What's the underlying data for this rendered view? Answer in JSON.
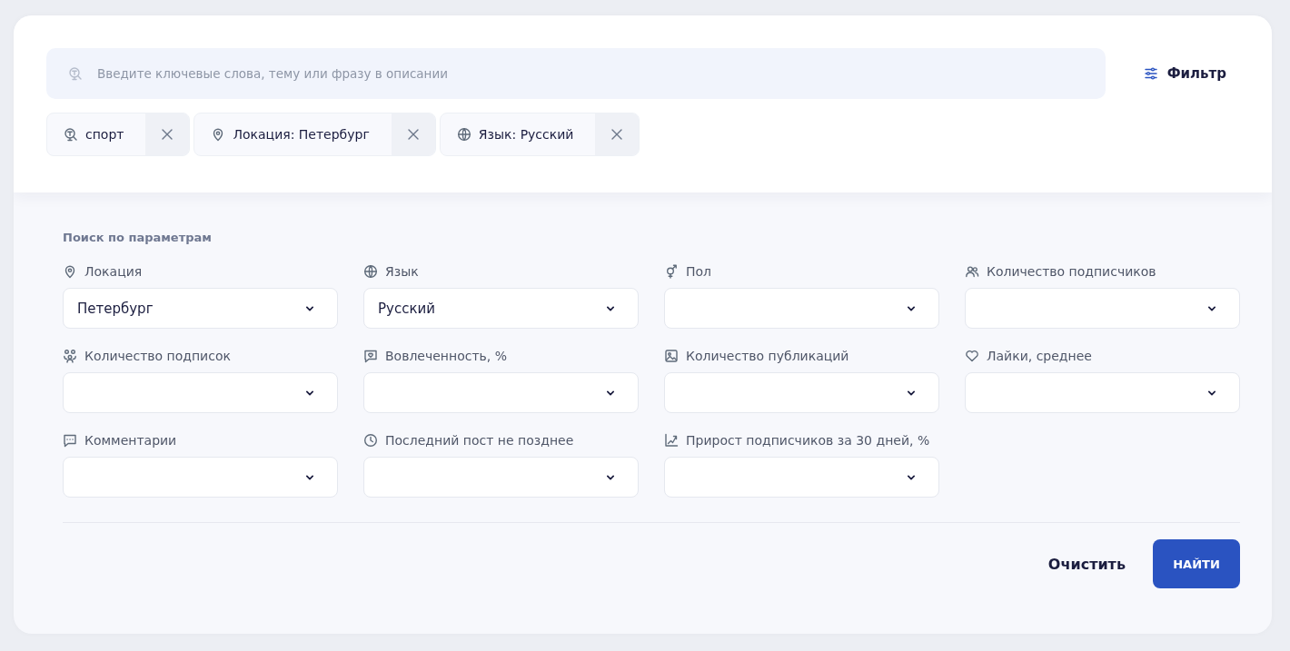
{
  "search": {
    "placeholder": "Введите ключевые слова, тему или фразу в описании"
  },
  "filter_button": {
    "label": "Фильтр"
  },
  "chips": [
    {
      "label": "спорт"
    },
    {
      "label": "Локация: Петербург"
    },
    {
      "label": "Язык: Русский"
    }
  ],
  "params": {
    "title": "Поиск по параметрам",
    "fields": [
      {
        "label": "Локация",
        "value": "Петербург"
      },
      {
        "label": "Язык",
        "value": "Русский"
      },
      {
        "label": "Пол"
      },
      {
        "label": "Количество подписчиков"
      },
      {
        "label": "Количество подписок"
      },
      {
        "label": "Вовлеченность, %"
      },
      {
        "label": "Количество публикаций"
      },
      {
        "label": "Лайки, среднее"
      },
      {
        "label": "Комментарии"
      },
      {
        "label": "Последний пост не позднее"
      },
      {
        "label": "Прирост подписчиков за 30 дней, %"
      }
    ]
  },
  "buttons": {
    "clear": "Очистить",
    "submit": "НАЙТИ"
  }
}
